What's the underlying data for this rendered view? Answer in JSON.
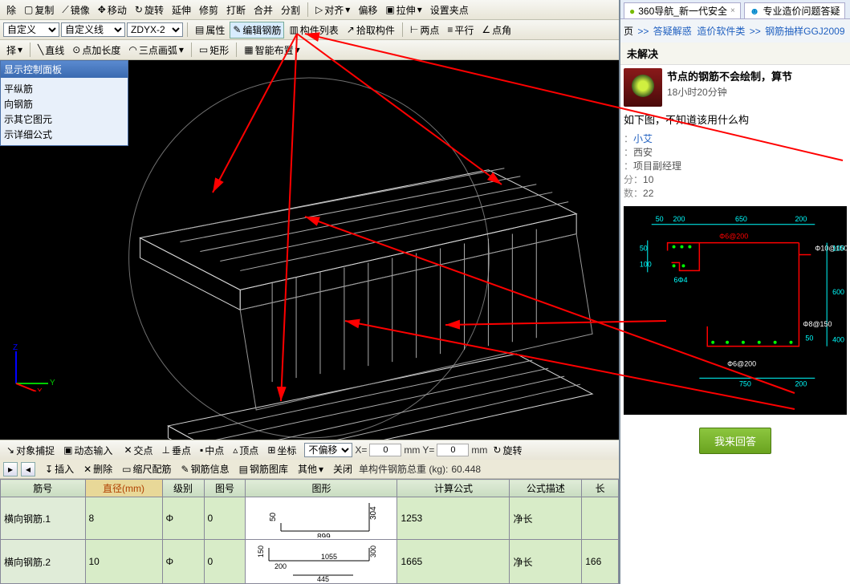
{
  "toolbar1": {
    "remove": "除",
    "copy": "复制",
    "mirror": "镜像",
    "move": "移动",
    "rotate": "旋转",
    "extend": "延伸",
    "trim": "修剪",
    "break": "打断",
    "merge": "合并",
    "split": "分割",
    "align": "对齐",
    "offset": "偏移",
    "stretch": "拉伸",
    "set_clip": "设置夹点"
  },
  "toolbar2": {
    "custom": "自定义",
    "custom_line": "自定义线",
    "zdyx": "ZDYX-2",
    "props": "属性",
    "edit_rebar": "编辑钢筋",
    "component_list": "构件列表",
    "pick_component": "拾取构件",
    "two_points": "两点",
    "parallel": "平行",
    "point_angle": "点角"
  },
  "toolbar3": {
    "choose": "择",
    "line": "直线",
    "add_len": "点加长度",
    "three_arc": "三点画弧",
    "rect": "矩形",
    "smart_layout": "智能布置"
  },
  "control_panel": {
    "title": "显示控制面板",
    "items": [
      "平纵筋",
      "向钢筋",
      "示其它图元",
      "示详细公式"
    ]
  },
  "statusbar1": {
    "obj_snap": "对象捕捉",
    "dyn_input": "动态输入",
    "intersect": "交点",
    "perp": "垂点",
    "mid": "中点",
    "vertex": "顶点",
    "coord": "坐标",
    "no_offset": "不偏移",
    "x_lbl": "X=",
    "x_val": "0",
    "y_lbl": "Y=",
    "y_val": "0",
    "mm": "mm",
    "rotate": "旋转"
  },
  "table_tools": {
    "insert": "插入",
    "delete": "删除",
    "scale_rebar": "缩尺配筋",
    "rebar_info": "钢筋信息",
    "rebar_lib": "钢筋图库",
    "other": "其他",
    "close": "关闭",
    "total_weight_label": "单构件钢筋总重 (kg):",
    "total_weight": "60.448"
  },
  "table": {
    "headers": [
      "筋号",
      "直径(mm)",
      "级别",
      "图号",
      "图形",
      "计算公式",
      "公式描述",
      "长"
    ],
    "rows": [
      {
        "name": "横向钢筋.1",
        "dia": "8",
        "grade": "Φ",
        "fig": "0",
        "calc": "1253",
        "desc": "净长",
        "len": ""
      },
      {
        "name": "横向钢筋.2",
        "dia": "10",
        "grade": "Φ",
        "fig": "0",
        "calc": "1665",
        "desc": "净长",
        "len": "166"
      }
    ],
    "diag1": {
      "a": "304",
      "b": "50",
      "c": "899"
    },
    "diag2": {
      "a": "150",
      "b": "200",
      "c": "1055",
      "d": "300",
      "e": "445"
    }
  },
  "browser": {
    "tab1": "360导航_新一代安全",
    "tab2": "专业造价问题答疑",
    "crumb_home": "页",
    "crumb1": "答疑解惑",
    "crumb2": "造价软件类",
    "crumb3": "钢筋抽样GGJ2009",
    "status": "未解决",
    "post_title": "节点的钢筋不会绘制，算节",
    "post_time": "18小时20分钟",
    "post_body": "如下图，不知道该用什么构",
    "meta_user_k": "：",
    "meta_user_v": "小艾",
    "meta_loc_k": "：",
    "meta_loc_v": "西安",
    "meta_role_k": "：",
    "meta_role_v": "项目副经理",
    "meta_score_k": "分：",
    "meta_score_v": "10",
    "meta_count_k": "数：",
    "meta_count_v": "22",
    "answer_btn": "我来回答"
  },
  "blueprint": {
    "d1": "50",
    "d2": "200",
    "d3": "650",
    "d4": "200",
    "d5": "Φ6@200",
    "d6": "100",
    "d7": "50",
    "d8": "6Φ4",
    "d9": "Φ10@150",
    "d10": "100",
    "d11": "600",
    "d12": "50",
    "d13": "Φ8@150",
    "d14": "400",
    "d15": "Φ6@200",
    "d16": "750",
    "d17": "200"
  }
}
